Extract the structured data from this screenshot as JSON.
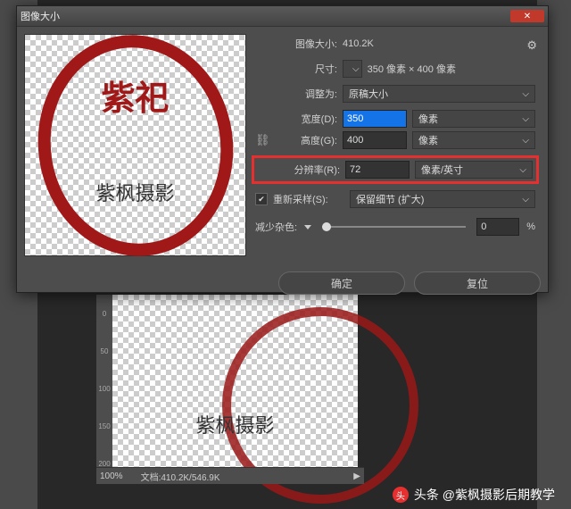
{
  "dialog": {
    "title": "图像大小",
    "image_size_label": "图像大小:",
    "image_size_value": "410.2K",
    "dimensions_label": "尺寸:",
    "dimensions_value": "350 像素 × 400 像素",
    "fit_to_label": "调整为:",
    "fit_to_value": "原稿大小",
    "width_label": "宽度(D):",
    "width_value": "350",
    "width_unit": "像素",
    "height_label": "高度(G):",
    "height_value": "400",
    "height_unit": "像素",
    "resolution_label": "分辨率(R):",
    "resolution_value": "72",
    "resolution_unit": "像素/英寸",
    "resample_label": "重新采样(S):",
    "resample_value": "保留细节 (扩大)",
    "noise_label": "减少杂色:",
    "noise_value": "0",
    "noise_unit": "%",
    "ok": "确定",
    "cancel": "复位",
    "preview_text": "紫枫摄影",
    "preview_chars": "紫祀"
  },
  "canvas": {
    "logo_text": "紫枫摄影",
    "ruler_marks": [
      "0",
      "50",
      "100",
      "150",
      "200"
    ]
  },
  "status": {
    "zoom": "100%",
    "doc": "文档:410.2K/546.9K"
  },
  "credit": {
    "text": "头条 @紫枫摄影后期教学"
  }
}
